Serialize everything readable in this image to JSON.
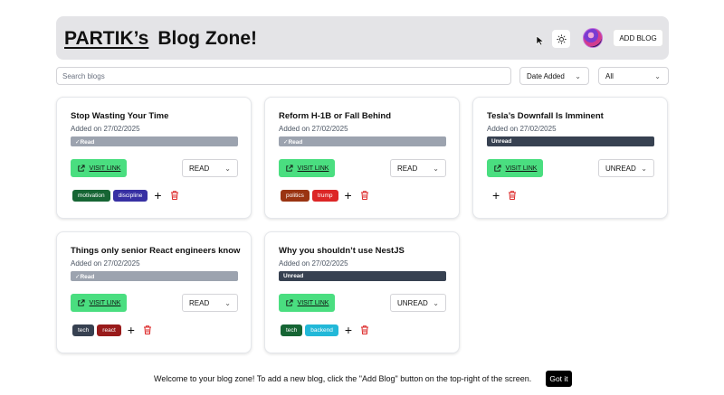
{
  "header": {
    "brand_name": "PARTIK’s",
    "brand_suffix": "Blog Zone!",
    "theme_icon": "sun-icon",
    "add_blog_label": "ADD BLOG"
  },
  "filters": {
    "search_placeholder": "Search blogs",
    "sort_value": "Date Added",
    "status_value": "All"
  },
  "colors": {
    "visit_link": "#4ade80",
    "read_badge": "#9ca3af",
    "unread_badge": "#374151",
    "delete_icon": "#dc2626"
  },
  "blogs": [
    {
      "title": "Stop Wasting Your Time",
      "date": "Added on 27/02/2025",
      "badge": "✓Read",
      "visit_label": "VISIT LINK",
      "status": "READ",
      "tags": [
        {
          "label": "motivation",
          "color": "#166534"
        },
        {
          "label": "discipline",
          "color": "#3730a3"
        }
      ]
    },
    {
      "title": "Reform H-1B or Fall Behind",
      "date": "Added on 27/02/2025",
      "badge": "✓Read",
      "visit_label": "VISIT LINK",
      "status": "READ",
      "tags": [
        {
          "label": "politics",
          "color": "#9a3412"
        },
        {
          "label": "trump",
          "color": "#dc2626"
        }
      ]
    },
    {
      "title": "Tesla’s Downfall Is Imminent",
      "date": "Added on 27/02/2025",
      "badge": "Unread",
      "visit_label": "VISIT LINK",
      "status": "UNREAD",
      "tags": []
    },
    {
      "title": "Things only senior React engineers know",
      "date": "Added on 27/02/2025",
      "badge": "✓Read",
      "visit_label": "VISIT LINK",
      "status": "READ",
      "tags": [
        {
          "label": "tech",
          "color": "#374151"
        },
        {
          "label": "react",
          "color": "#991b1b"
        }
      ]
    },
    {
      "title": "Why you shouldn’t use NestJS",
      "date": "Added on 27/02/2025",
      "badge": "Unread",
      "visit_label": "VISIT LINK",
      "status": "UNREAD",
      "tags": [
        {
          "label": "tech",
          "color": "#166534"
        },
        {
          "label": "backend",
          "color": "#22b8d8"
        }
      ]
    }
  ],
  "toast": {
    "message": "Welcome to your blog zone! To add a new blog, click the \"Add Blog\" button on the top-right of the screen.",
    "button_label": "Got it"
  }
}
